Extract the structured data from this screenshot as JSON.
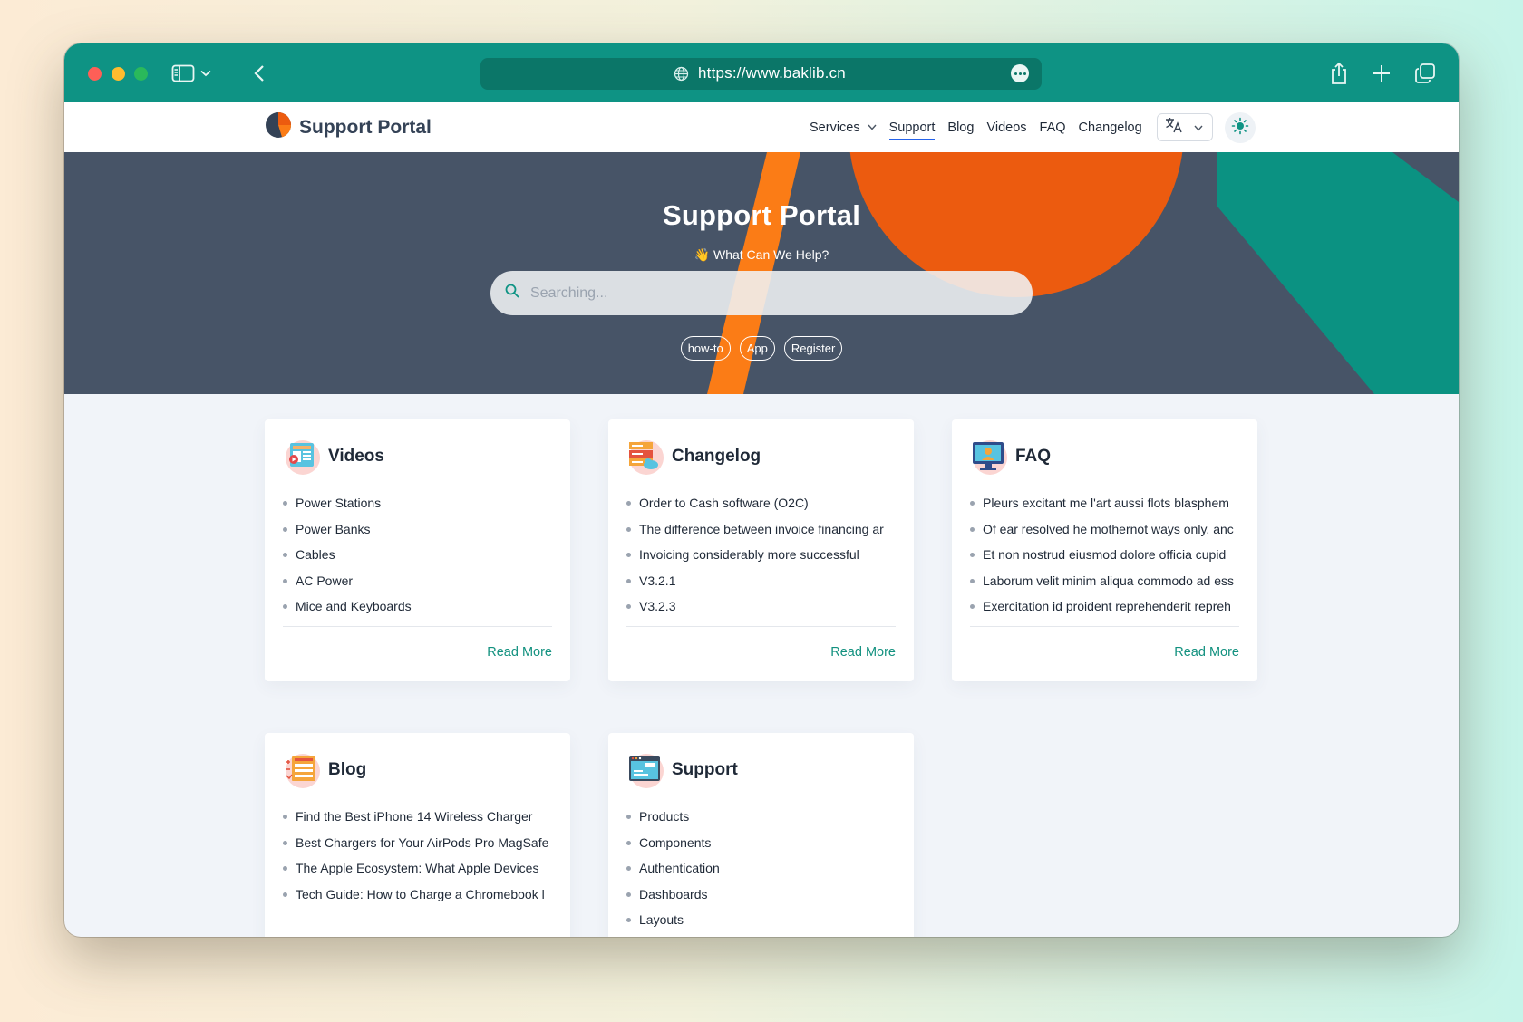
{
  "browser": {
    "url": "https://www.baklib.cn"
  },
  "site": {
    "brand": "Support Portal",
    "nav": [
      {
        "label": "Services"
      },
      {
        "label": "Support"
      },
      {
        "label": "Blog"
      },
      {
        "label": "Videos"
      },
      {
        "label": "FAQ"
      },
      {
        "label": "Changelog"
      }
    ]
  },
  "hero": {
    "title": "Support Portal",
    "subtitle": "👋 What Can We Help?",
    "search_placeholder": "Searching...",
    "tags": [
      "how-to",
      "App",
      "Register"
    ]
  },
  "cards": [
    {
      "title": "Videos",
      "icon": "video-gallery-icon",
      "items": [
        "Power Stations",
        "Power Banks",
        "Cables",
        "AC Power",
        "Mice and Keyboards"
      ],
      "read_more": "Read More"
    },
    {
      "title": "Changelog",
      "icon": "server-cloud-icon",
      "items": [
        "Order to Cash software (O2C)",
        "The difference between invoice financing ar",
        "Invoicing considerably more successful",
        "V3.2.1",
        "V3.2.3"
      ],
      "read_more": "Read More"
    },
    {
      "title": "FAQ",
      "icon": "monitor-support-icon",
      "items": [
        "Pleurs excitant me l'art aussi flots blasphem",
        "Of ear resolved he mothernot ways only, anc",
        "Et non nostrud eiusmod dolore officia cupid",
        "Laborum velit minim aliqua commodo ad ess",
        "Exercitation id proident reprehenderit repreh"
      ],
      "read_more": "Read More"
    },
    {
      "title": "Blog",
      "icon": "article-list-icon",
      "items": [
        "Find the Best iPhone 14 Wireless Charger",
        "Best Chargers for Your AirPods Pro MagSafe",
        "The Apple Ecosystem: What Apple Devices",
        "Tech Guide: How to Charge a Chromebook l"
      ],
      "read_more": ""
    },
    {
      "title": "Support",
      "icon": "browser-window-icon",
      "items": [
        "Products",
        "Components",
        "Authentication",
        "Dashboards",
        "Layouts"
      ],
      "read_more": ""
    }
  ],
  "colors": {
    "titlebar": "#0e9384",
    "hero_bg": "#475467",
    "hero_orange": "#ec5b0f",
    "hero_stripe": "#fb7c16",
    "hero_teal": "#0b9282",
    "link": "#12917f",
    "nav_active_underline": "#2563eb"
  }
}
